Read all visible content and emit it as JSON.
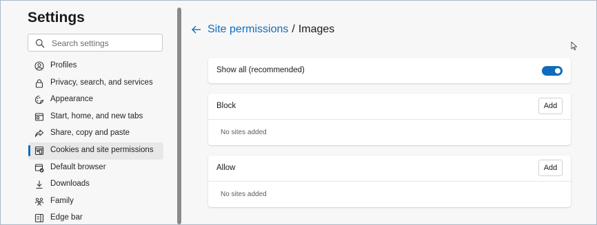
{
  "sidebar": {
    "title": "Settings",
    "search_placeholder": "Search settings",
    "items": [
      {
        "label": "Profiles",
        "icon": "profile-icon"
      },
      {
        "label": "Privacy, search, and services",
        "icon": "lock-icon"
      },
      {
        "label": "Appearance",
        "icon": "appearance-icon"
      },
      {
        "label": "Start, home, and new tabs",
        "icon": "start-tabs-icon"
      },
      {
        "label": "Share, copy and paste",
        "icon": "share-icon"
      },
      {
        "label": "Cookies and site permissions",
        "icon": "cookies-permissions-icon",
        "active": true
      },
      {
        "label": "Default browser",
        "icon": "default-browser-icon"
      },
      {
        "label": "Downloads",
        "icon": "download-icon"
      },
      {
        "label": "Family",
        "icon": "family-icon"
      },
      {
        "label": "Edge bar",
        "icon": "edge-bar-icon"
      }
    ]
  },
  "main": {
    "breadcrumb": {
      "parent": "Site permissions",
      "separator": "/",
      "current": "Images"
    },
    "show_all": {
      "label": "Show all (recommended)",
      "enabled": true
    },
    "block": {
      "label": "Block",
      "add_label": "Add",
      "empty_text": "No sites added"
    },
    "allow": {
      "label": "Allow",
      "add_label": "Add",
      "empty_text": "No sites added"
    }
  },
  "colors": {
    "accent": "#0f6cbd",
    "background": "#f7f7f7",
    "card": "#ffffff"
  }
}
